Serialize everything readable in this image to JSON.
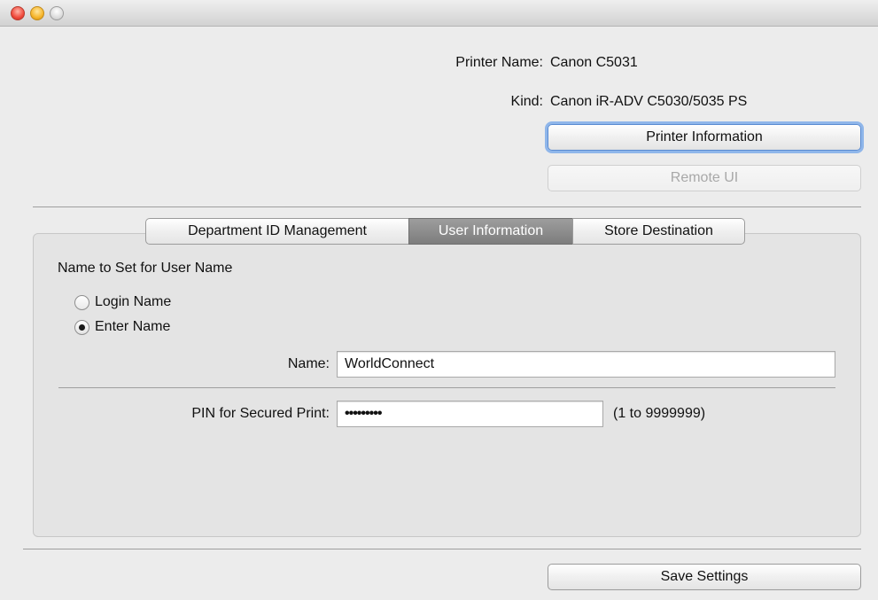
{
  "window": {
    "traffic_lights": [
      "close",
      "minimize",
      "zoom"
    ]
  },
  "printer": {
    "name_label": "Printer Name:",
    "name_value": "Canon C5031",
    "kind_label": "Kind:",
    "kind_value": "Canon iR-ADV C5030/5035 PS",
    "info_button": "Printer Information",
    "remote_button": "Remote UI"
  },
  "tabs": [
    {
      "label": "Department ID Management",
      "selected": false
    },
    {
      "label": "User Information",
      "selected": true
    },
    {
      "label": "Store Destination",
      "selected": false
    }
  ],
  "user_info": {
    "section_title": "Name to Set for User Name",
    "radio_login": "Login Name",
    "radio_enter": "Enter Name",
    "selected_radio": "Enter Name",
    "name_label": "Name:",
    "name_value": "WorldConnect",
    "pin_label": "PIN for Secured Print:",
    "pin_value": "•••••••••",
    "pin_range": "(1 to 9999999)"
  },
  "footer": {
    "save_button": "Save Settings"
  },
  "colors": {
    "selected_tab": "#8a8a8a",
    "focus_ring": "#8fb6ea",
    "close_button": "#f04a3c",
    "minimize_button": "#f6b52a"
  }
}
